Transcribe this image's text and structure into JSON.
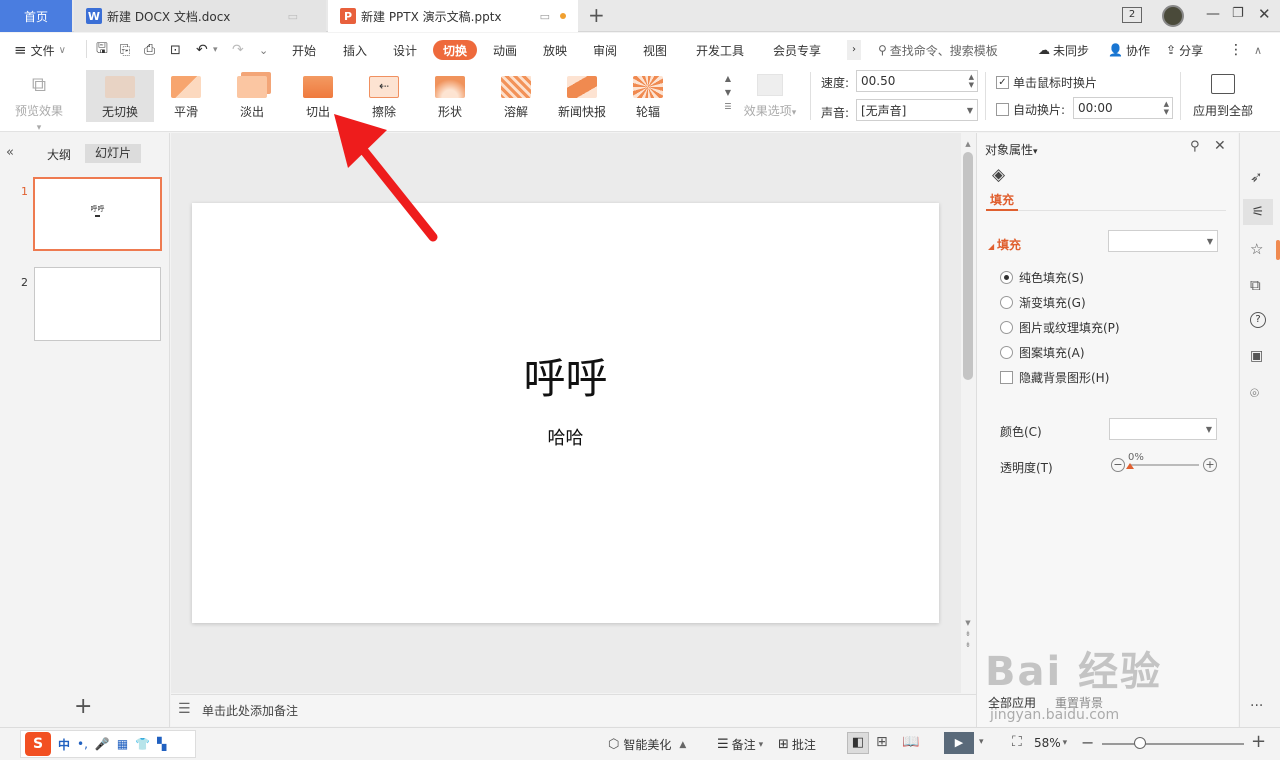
{
  "tabs": {
    "home": "首页",
    "doc1": "新建 DOCX 文档.docx",
    "doc2": "新建 PPTX 演示文稿.pptx",
    "doc1_icon": "W",
    "doc2_icon": "P",
    "window_count": "2"
  },
  "menu": {
    "file": "文件",
    "items": [
      "开始",
      "插入",
      "设计",
      "切换",
      "动画",
      "放映",
      "审阅",
      "视图",
      "开发工具",
      "会员专享"
    ],
    "active": "切换",
    "search": "查找命令、搜索模板",
    "sync": "未同步",
    "collab": "协作",
    "share": "分享"
  },
  "ribbon": {
    "preview": "预览效果",
    "transitions": [
      "无切换",
      "平滑",
      "淡出",
      "切出",
      "擦除",
      "形状",
      "溶解",
      "新闻快报",
      "轮辐"
    ],
    "effect_options": "效果选项",
    "speed_label": "速度:",
    "speed_value": "00.50",
    "sound_label": "声音:",
    "sound_value": "[无声音]",
    "on_click": "单击鼠标时换片",
    "on_click_checked": true,
    "auto_label": "自动换片:",
    "auto_value": "00:00",
    "auto_checked": false,
    "apply_all": "应用到全部"
  },
  "left": {
    "outline_tab": "大纲",
    "slides_tab": "幻灯片",
    "slides": [
      {
        "num": "1",
        "title": "呼呼"
      },
      {
        "num": "2",
        "title": ""
      }
    ]
  },
  "slide": {
    "title": "呼呼",
    "subtitle": "哈哈"
  },
  "notes_placeholder": "单击此处添加备注",
  "props": {
    "header": "对象属性",
    "fill_tab": "填充",
    "section": "填充",
    "options": [
      "纯色填充(S)",
      "渐变填充(G)",
      "图片或纹理填充(P)",
      "图案填充(A)"
    ],
    "selected": "纯色填充(S)",
    "hide_bg": "隐藏背景图形(H)",
    "color_label": "颜色(C)",
    "transparency_label": "透明度(T)",
    "transparency_value": "0%",
    "apply_all": "全部应用",
    "reset_bg": "重置背景"
  },
  "status": {
    "beautify": "智能美化",
    "notes": "备注",
    "comment": "批注",
    "zoom": "58%"
  },
  "watermark": {
    "brand": "Bai 经验",
    "url": "jingyan.baidu.com"
  },
  "colors": {
    "accent": "#ee6a3c",
    "home_tab": "#4a7de0",
    "arrow": "#ee1c1c"
  }
}
